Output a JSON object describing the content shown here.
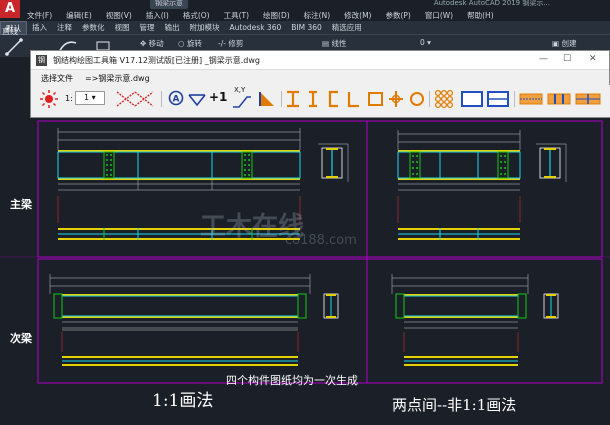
{
  "app": {
    "logo": "A",
    "doc_tab": "钢梁示意",
    "title": "Autodesk AutoCAD 2019 钢梁示..."
  },
  "menubar": [
    "文件(F)",
    "编辑(E)",
    "视图(V)",
    "插入(I)",
    "格式(O)",
    "工具(T)",
    "绘图(D)",
    "标注(N)",
    "修改(M)",
    "参数(P)",
    "窗口(W)",
    "帮助(H)"
  ],
  "ribbon_tabs": [
    "默认",
    "插入",
    "注释",
    "参数化",
    "视图",
    "管理",
    "输出",
    "附加模块",
    "Autodesk 360",
    "BIM 360",
    "精选应用"
  ],
  "ribbon": {
    "move": "移动",
    "rotate": "旋转",
    "trim": "修剪",
    "linetype": "线性",
    "layer_value": "0",
    "create": "创建",
    "line": "直线"
  },
  "tool_window": {
    "title": "钢结构绘图工具箱 V17.12测试版[已注册] _钢梁示意.dwg",
    "menu_select": "选择文件",
    "menu_file": "=>钢梁示意.dwg",
    "scale_label": "1:",
    "scale_value": "1",
    "plus_one": "+1",
    "xy_label": "X,Y"
  },
  "drawing": {
    "main_beam_label": "主梁",
    "sub_beam_label": "次梁",
    "caption_center": "四个构件图纸均为一次生成",
    "caption_left": "1:1画法",
    "caption_right": "两点间--非1:1画法",
    "watermark": "工木在线",
    "watermark_url": "co188.com"
  },
  "colors": {
    "background": "#1a1f28",
    "frame": "#b000c8",
    "yellow": "#e6d100",
    "cyan": "#18d8e8",
    "green": "#18c818",
    "white": "#ffffff",
    "red": "#d83030",
    "orange": "#e07b00",
    "blue": "#2050c0"
  }
}
